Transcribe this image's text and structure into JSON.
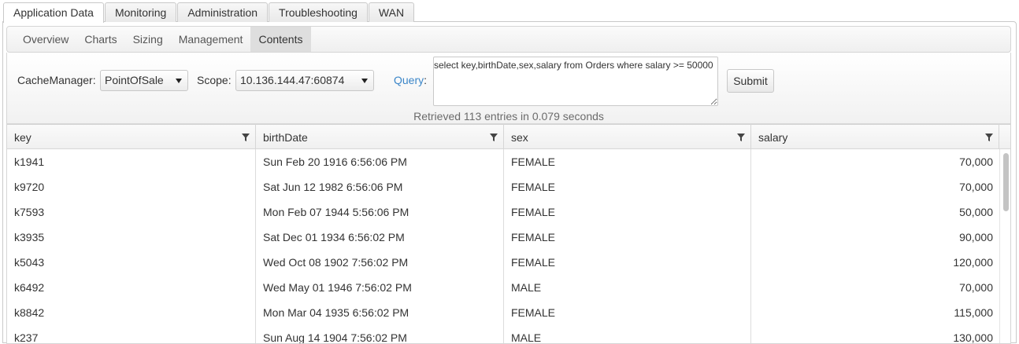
{
  "top_tabs": [
    {
      "label": "Application Data",
      "active": true
    },
    {
      "label": "Monitoring",
      "active": false
    },
    {
      "label": "Administration",
      "active": false
    },
    {
      "label": "Troubleshooting",
      "active": false
    },
    {
      "label": "WAN",
      "active": false
    }
  ],
  "sub_tabs": [
    {
      "label": "Overview",
      "active": false
    },
    {
      "label": "Charts",
      "active": false
    },
    {
      "label": "Sizing",
      "active": false
    },
    {
      "label": "Management",
      "active": false
    },
    {
      "label": "Contents",
      "active": true
    }
  ],
  "query_panel": {
    "cache_manager_label": "CacheManager:",
    "cache_manager_value": "PointOfSale",
    "scope_label": "Scope:",
    "scope_value": "10.136.144.47:60874",
    "query_label": "Query",
    "query_colon": ":",
    "query_text": "select key,birthDate,sex,salary from Orders where salary >= 50000",
    "submit_label": "Submit",
    "status": "Retrieved 113 entries in 0.079 seconds"
  },
  "grid": {
    "columns": [
      "key",
      "birthDate",
      "sex",
      "salary"
    ],
    "rows": [
      [
        "k1941",
        "Sun Feb 20 1916 6:56:06 PM",
        "FEMALE",
        "70,000"
      ],
      [
        "k9720",
        "Sat Jun 12 1982 6:56:06 PM",
        "FEMALE",
        "70,000"
      ],
      [
        "k7593",
        "Mon Feb 07 1944 5:56:06 PM",
        "FEMALE",
        "50,000"
      ],
      [
        "k3935",
        "Sat Dec 01 1934 6:56:02 PM",
        "FEMALE",
        "90,000"
      ],
      [
        "k5043",
        "Wed Oct 08 1902 7:56:02 PM",
        "FEMALE",
        "120,000"
      ],
      [
        "k6492",
        "Wed May 01 1946 7:56:02 PM",
        "MALE",
        "70,000"
      ],
      [
        "k8842",
        "Mon Mar 04 1935 6:56:02 PM",
        "FEMALE",
        "115,000"
      ],
      [
        "k237",
        "Sun Aug 14 1904 7:56:02 PM",
        "MALE",
        "130,000"
      ]
    ]
  },
  "colors": {
    "accent_link": "#3b86c8",
    "border": "#d6d6d6",
    "active_subtab_bg": "#dedede"
  },
  "icons": {
    "filter": "filter-icon",
    "dropdown": "chevron-down-icon"
  }
}
